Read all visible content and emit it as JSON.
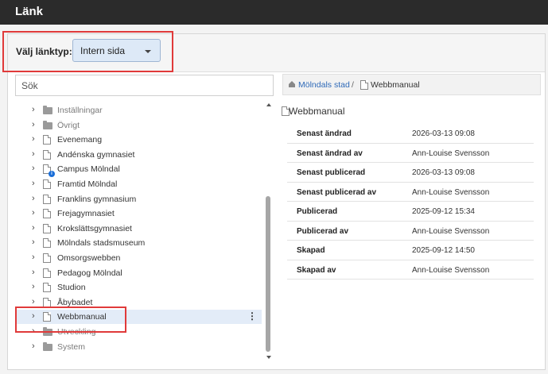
{
  "window": {
    "title": "Länk"
  },
  "link_type": {
    "label": "Välj länktyp:",
    "value": "Intern sida"
  },
  "search": {
    "placeholder": "Sök"
  },
  "tree": {
    "items": [
      {
        "label": "Inställningar",
        "icon": "folder-icon",
        "dim": true
      },
      {
        "label": "Övrigt",
        "icon": "folder-icon",
        "dim": true
      },
      {
        "label": "Evenemang",
        "icon": "document-icon"
      },
      {
        "label": "Andénska gymnasiet",
        "icon": "document-icon"
      },
      {
        "label": "Campus Mölndal",
        "icon": "document-info-icon"
      },
      {
        "label": "Framtid Mölndal",
        "icon": "document-icon"
      },
      {
        "label": "Franklins gymnasium",
        "icon": "document-icon"
      },
      {
        "label": "Frejagymnasiet",
        "icon": "document-icon"
      },
      {
        "label": "Krokslättsgymnasiet",
        "icon": "document-icon"
      },
      {
        "label": "Mölndals stadsmuseum",
        "icon": "document-icon"
      },
      {
        "label": "Omsorgswebben",
        "icon": "document-icon"
      },
      {
        "label": "Pedagog Mölndal",
        "icon": "document-icon"
      },
      {
        "label": "Studion",
        "icon": "document-icon"
      },
      {
        "label": "Åbybadet",
        "icon": "document-icon"
      },
      {
        "label": "Webbmanual",
        "icon": "document-icon",
        "selected": true,
        "menu": "⋮"
      },
      {
        "label": "Utveckling",
        "icon": "folder-icon",
        "dim": true
      },
      {
        "label": "System",
        "icon": "folder-icon",
        "dim": true
      }
    ]
  },
  "breadcrumb": {
    "root": "Mölndals stad",
    "separator": "/",
    "current": "Webbmanual"
  },
  "page": {
    "title": "Webbmanual"
  },
  "info": [
    {
      "key": "Senast ändrad",
      "value": "2026-03-13 09:08"
    },
    {
      "key": "Senast ändrad av",
      "value": "Ann-Louise Svensson"
    },
    {
      "key": "Senast publicerad",
      "value": "2026-03-13 09:08"
    },
    {
      "key": "Senast publicerad av",
      "value": "Ann-Louise Svensson"
    },
    {
      "key": "Publicerad",
      "value": "2025-09-12 15:34"
    },
    {
      "key": "Publicerad av",
      "value": "Ann-Louise Svensson"
    },
    {
      "key": "Skapad",
      "value": "2025-09-12 14:50"
    },
    {
      "key": "Skapad av",
      "value": "Ann-Louise Svensson"
    }
  ],
  "colors": {
    "titlebar": "#2b2b2b",
    "highlight": "#e03a3a",
    "select_bg": "#dde9f7",
    "link": "#2f6ab8"
  }
}
